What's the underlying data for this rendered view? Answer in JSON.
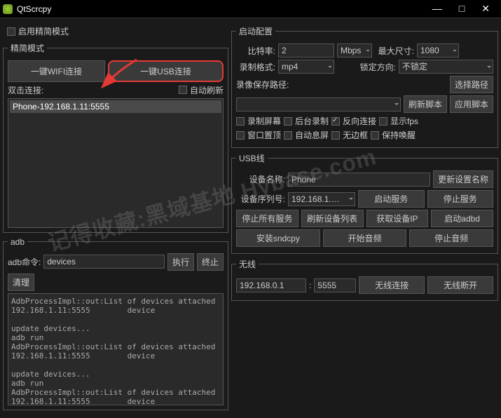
{
  "title": "QtScrcpy",
  "left": {
    "simple_mode": "启用精简模式",
    "simple_group": "精简模式",
    "wifi_btn": "一键WIFI连接",
    "usb_btn": "一键USB连接",
    "dblclick": "双击连接:",
    "auto_refresh": "自动刷新",
    "device": "Phone-192.168.1.11:5555",
    "adb_group": "adb",
    "adb_cmd_label": "adb命令:",
    "adb_cmd_value": "devices",
    "exec": "执行",
    "stop": "终止",
    "clear": "清理",
    "log": "AdbProcessImpl::out:List of devices attached\n192.168.1.11:5555        device\n\nupdate devices...\nadb run\nAdbProcessImpl::out:List of devices attached\n192.168.1.11:5555        device\n\nupdate devices...\nadb run\nAdbProcessImpl::out:List of devices attached\n192.168.1.11:5555        device"
  },
  "right": {
    "launch_group": "启动配置",
    "bitrate": "比特率:",
    "bitrate_val": "2",
    "bitrate_unit": "Mbps",
    "maxsize": "最大尺寸:",
    "maxsize_val": "1080",
    "rec_format": "录制格式:",
    "rec_format_val": "mp4",
    "lock_orient": "锁定方向:",
    "lock_orient_val": "不锁定",
    "rec_path": "录像保存路径:",
    "select_path": "选择路径",
    "refresh_script": "刷新脚本",
    "apply_script": "应用脚本",
    "rec_screen": "录制屏幕",
    "bg_record": "后台录制",
    "reverse_conn": "反向连接",
    "show_fps": "显示fps",
    "always_top": "窗口置顶",
    "auto_sleep": "自动息屏",
    "no_border": "无边框",
    "keep_wake": "保持唤醒",
    "usb_group": "USB线",
    "dev_name": "设备名称:",
    "dev_name_val": "Phone",
    "update_name": "更新设置名称",
    "dev_serial": "设备序列号:",
    "dev_serial_val": "192.168.1.…",
    "start_service": "启动服务",
    "stop_service": "停止服务",
    "stop_all": "停止所有服务",
    "refresh_list": "刷新设备列表",
    "get_ip": "获取设备IP",
    "start_adbd": "启动adbd",
    "install_sndcpy": "安装sndcpy",
    "start_audio": "开始音频",
    "stop_audio": "停止音频",
    "wireless_group": "无线",
    "ip": "192.168.0.1",
    "port_sep": ":",
    "port": "5555",
    "wl_connect": "无线连接",
    "wl_disconnect": "无线断开"
  },
  "watermark": "记得收藏:黑域基地\n        Hybase.com"
}
